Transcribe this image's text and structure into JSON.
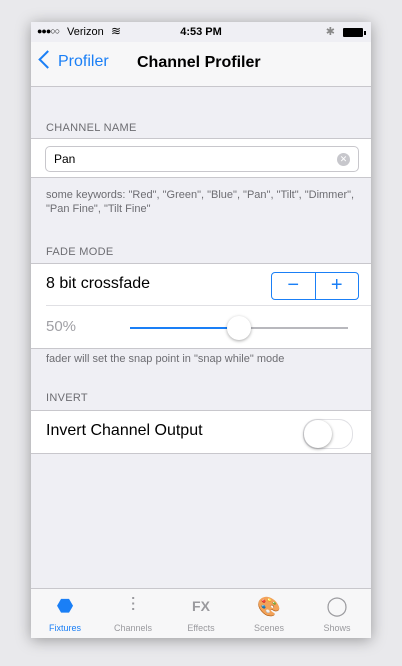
{
  "status_bar": {
    "signal": "●●●○○",
    "carrier": "Verizon",
    "time": "4:53 PM"
  },
  "nav": {
    "back_label": "Profiler",
    "title": "Channel Profiler"
  },
  "channel_name": {
    "header": "CHANNEL NAME",
    "value": "Pan",
    "footer": "some keywords: \"Red\", \"Green\", \"Blue\", \"Pan\", \"Tilt\", \"Dimmer\", \"Pan Fine\", \"Tilt Fine\""
  },
  "fade_mode": {
    "header": "FADE MODE",
    "label": "8 bit crossfade",
    "minus": "−",
    "plus": "+",
    "percent_label": "50%",
    "slider_value": 0.5,
    "footer": "fader will set the snap point in \"snap while\" mode"
  },
  "invert": {
    "header": "INVERT",
    "label": "Invert Channel Output",
    "on": false
  },
  "tabs": [
    {
      "label": "Fixtures",
      "icon": "fixtures-icon",
      "glyph": "⬣",
      "active": true
    },
    {
      "label": "Channels",
      "icon": "channels-icon",
      "glyph": "⫶",
      "active": false
    },
    {
      "label": "Effects",
      "icon": "effects-icon",
      "glyph": "FX",
      "active": false
    },
    {
      "label": "Scenes",
      "icon": "palette-icon",
      "glyph": "🎨",
      "active": false
    },
    {
      "label": "Shows",
      "icon": "shows-icon",
      "glyph": "◯",
      "active": false
    }
  ],
  "colors": {
    "accent": "#1a7ff6",
    "background": "#efeff4"
  }
}
